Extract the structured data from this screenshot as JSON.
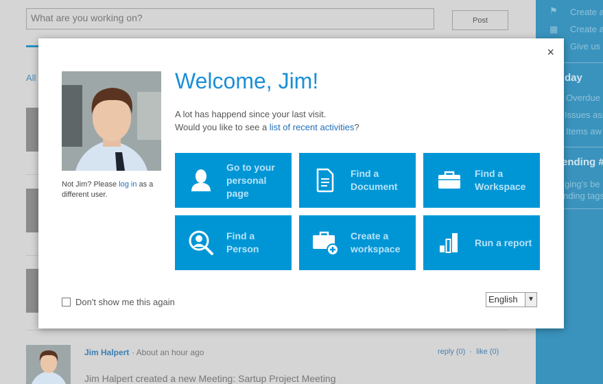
{
  "composer": {
    "placeholder": "What are you working on?",
    "post_label": "Post"
  },
  "feed": {
    "tab_all": "All",
    "post": {
      "author": "Jim Halpert",
      "sep": "·",
      "time": "About an hour ago",
      "reply": "reply (0)",
      "like": "like (0)",
      "text": "Jim Halpert created a new Meeting: Sartup Project Meeting"
    }
  },
  "sidebar": {
    "actions": [
      "Create a",
      "Create a",
      "Give us"
    ],
    "today_heading": "day",
    "today_items": [
      "Overdue",
      "Issues ass",
      "Items aw"
    ],
    "trending_heading": "ending #",
    "trending_text": [
      "ging's be",
      "nding tags"
    ]
  },
  "modal": {
    "close": "×",
    "title": "Welcome, Jim!",
    "intro1": "A lot has happend since your last visit.",
    "intro2_pre": "Would you like to see a ",
    "intro2_link": "list of recent activities",
    "intro2_post": "?",
    "notjim_pre": "Not Jim? Please ",
    "notjim_link": "log in",
    "notjim_post": " as a different user.",
    "tiles": [
      {
        "label": "Go to your personal page",
        "icon": "user-icon"
      },
      {
        "label": "Find a Document",
        "icon": "document-icon"
      },
      {
        "label": "Find a Workspace",
        "icon": "briefcase-icon"
      },
      {
        "label": "Find a Person",
        "icon": "person-search-icon"
      },
      {
        "label": "Create a workspace",
        "icon": "briefcase-add-icon"
      },
      {
        "label": "Run a report",
        "icon": "bar-chart-icon"
      }
    ],
    "dont_show": "Don't show me this again",
    "language": "English"
  },
  "colors": {
    "accent": "#0096d6",
    "tile_text": "#b9e3f8",
    "sidebar": "#3a93bd"
  }
}
